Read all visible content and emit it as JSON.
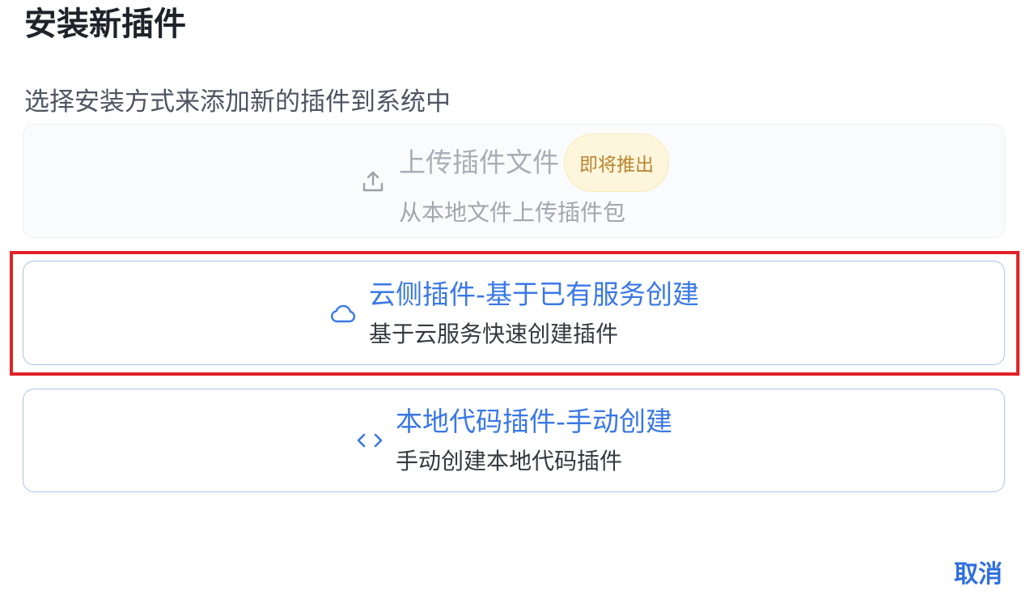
{
  "dialog": {
    "title": "安装新插件",
    "subtitle": "选择安装方式来添加新的插件到系统中"
  },
  "options": [
    {
      "icon": "upload-icon",
      "title": "上传插件文件",
      "badge": "即将推出",
      "description": "从本地文件上传插件包",
      "disabled": true
    },
    {
      "icon": "cloud-icon",
      "title": "云侧插件-基于已有服务创建",
      "description": "基于云服务快速创建插件",
      "highlighted": true
    },
    {
      "icon": "code-icon",
      "title": "本地代码插件-手动创建",
      "description": "手动创建本地代码插件"
    }
  ],
  "actions": {
    "cancel_label": "取消"
  },
  "colors": {
    "accent": "#3a78e6",
    "highlight": "#e02128",
    "badge_bg": "#fdf6dc",
    "badge_text": "#b98530"
  }
}
